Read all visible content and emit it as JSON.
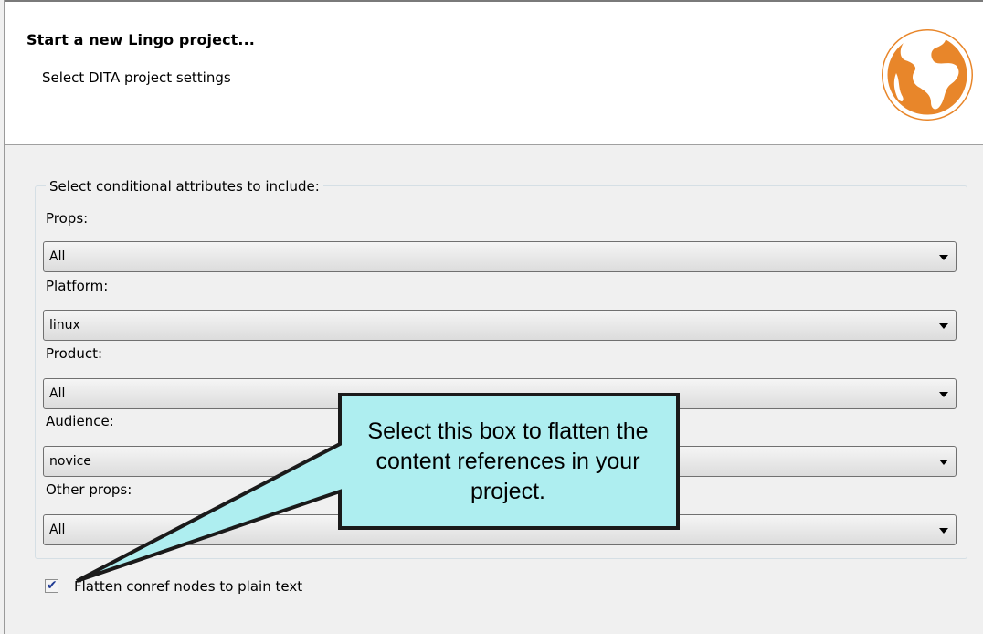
{
  "header": {
    "title": "Start a new Lingo project...",
    "subtitle": "Select DITA project settings",
    "logo": "globe-icon",
    "logo_color": "#e8862a"
  },
  "group": {
    "legend": "Select conditional attributes to include:",
    "fields": [
      {
        "label": "Props:",
        "value": "All"
      },
      {
        "label": "Platform:",
        "value": "linux"
      },
      {
        "label": "Product:",
        "value": "All"
      },
      {
        "label": "Audience:",
        "value": "novice"
      },
      {
        "label": "Other props:",
        "value": "All"
      }
    ]
  },
  "flatten": {
    "label": "Flatten conref nodes to plain text",
    "checked": true
  },
  "callout": {
    "text": "Select this box to flatten the content references in your project.",
    "fill_color": "#aeeef0"
  }
}
